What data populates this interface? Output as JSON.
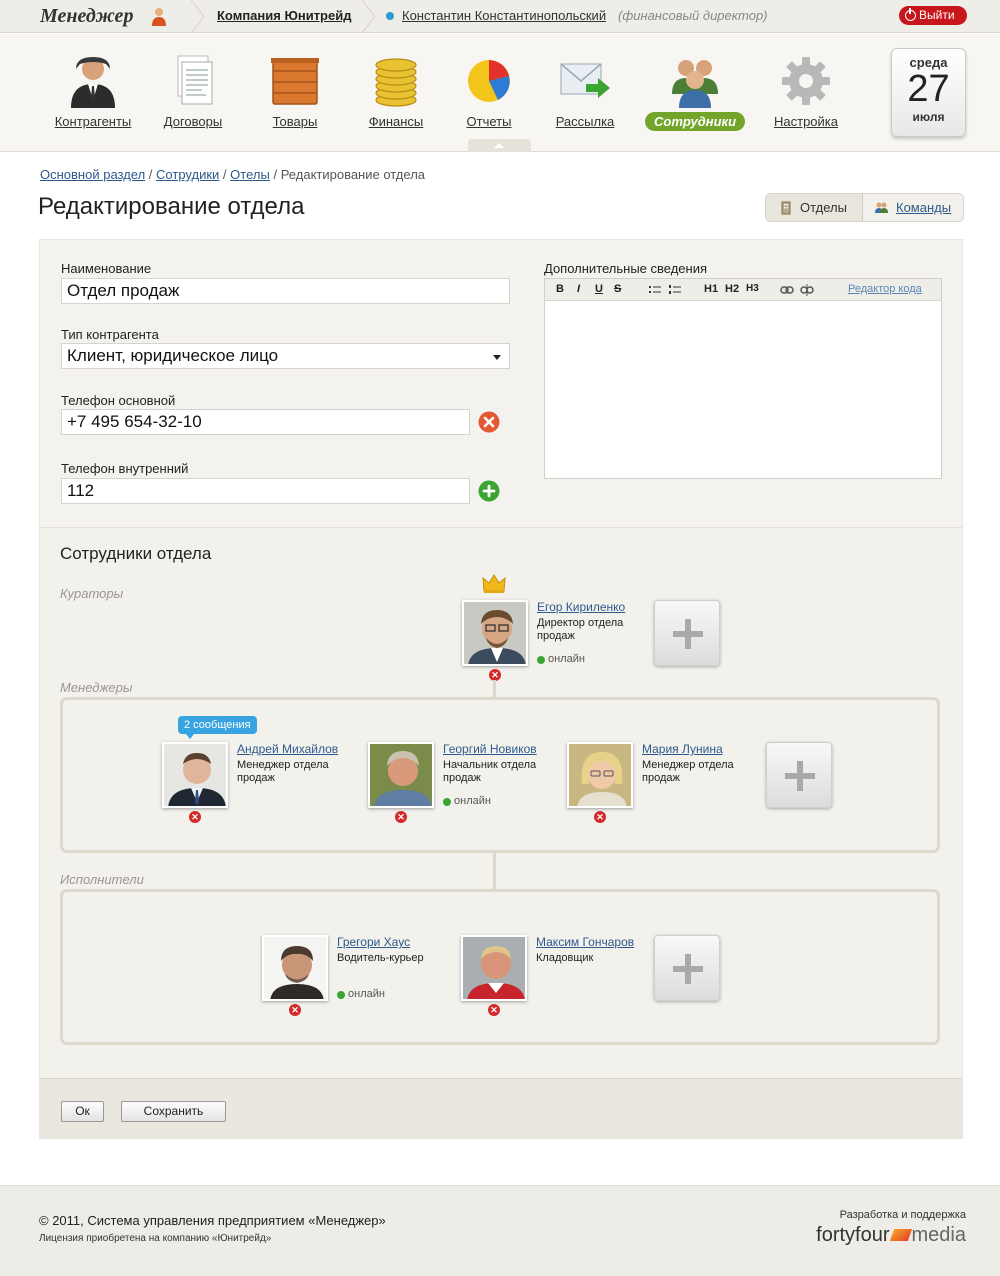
{
  "topbar": {
    "logo": "Менеджер",
    "company": "Компания Юнитрейд",
    "user_name": "Константин Константинопольский",
    "user_role": "(финансовый директор)",
    "logout": "Выйти"
  },
  "nav": {
    "items": [
      {
        "label": "Контрагенты",
        "icon": "person-icon"
      },
      {
        "label": "Договоры",
        "icon": "documents-icon"
      },
      {
        "label": "Товары",
        "icon": "box-icon"
      },
      {
        "label": "Финансы",
        "icon": "coins-icon"
      },
      {
        "label": "Отчеты",
        "icon": "pie-chart-icon"
      },
      {
        "label": "Рассылка",
        "icon": "mail-icon"
      },
      {
        "label": "Сотрудники",
        "icon": "people-icon",
        "active": true
      },
      {
        "label": "Настройка",
        "icon": "gear-icon"
      }
    ],
    "calendar": {
      "weekday": "среда",
      "day": "27",
      "month": "июля"
    }
  },
  "breadcrumb": {
    "items": [
      "Основной раздел",
      "Сотрудики",
      "Отелы"
    ],
    "current": "Редактирование отдела",
    "sep": "/"
  },
  "page": {
    "title": "Редактирование отдела",
    "switch_departments": "Отделы",
    "switch_teams": "Команды"
  },
  "form": {
    "name_label": "Наименование",
    "name_value": "Отдел продаж",
    "type_label": "Тип контрагента",
    "type_value": "Клиент, юридическое лицо",
    "phone_main_label": "Телефон основной",
    "phone_main_value": "+7 495 654-32-10",
    "phone_internal_label": "Телефон внутренний",
    "phone_internal_value": "112",
    "extra_label": "Дополнительные сведения",
    "toolbar": {
      "bold": "B",
      "italic": "I",
      "underline": "U",
      "strike": "S",
      "h1": "H1",
      "h2": "H2",
      "h3": "H3",
      "code_editor": "Редактор кода"
    }
  },
  "staff": {
    "title": "Сотрудники отдела",
    "curators_label": "Кураторы",
    "managers_label": "Менеджеры",
    "performers_label": "Исполнители",
    "online": "онлайн",
    "curators": [
      {
        "name": "Егор Кириленко",
        "role": "Директор отдела продаж",
        "online": true
      }
    ],
    "managers": [
      {
        "name": "Андрей Михайлов",
        "role": "Менеджер отдела продаж",
        "badge": "2 сообщения"
      },
      {
        "name": "Георгий Новиков",
        "role": "Начальник отдела продаж",
        "online": true
      },
      {
        "name": "Мария Лунина",
        "role": "Менеджер отдела продаж"
      }
    ],
    "performers": [
      {
        "name": "Грегори Хаус",
        "role": "Водитель-курьер",
        "online": true
      },
      {
        "name": "Максим Гончаров",
        "role": "Кладовщик"
      }
    ]
  },
  "buttons": {
    "ok": "Ок",
    "save": "Сохранить"
  },
  "footer": {
    "copyright": "© 2011, Система управления предприятием «Менеджер»",
    "license": "Лицензия приобретена на компанию «Юнитрейд»",
    "dev": "Разработка и поддержка",
    "brand_a": "fortyfour",
    "brand_b": "media"
  },
  "colors": {
    "accent_green": "#73a52a",
    "logout_red": "#c8161d",
    "link_blue": "#2d5a8c",
    "online_green": "#3aa531"
  }
}
